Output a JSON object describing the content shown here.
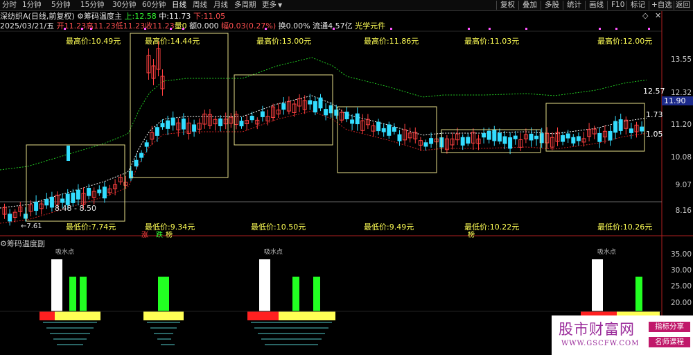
{
  "toolbar": {
    "periods": [
      "分时",
      "1分钟",
      "5分钟",
      "15分钟",
      "30分钟",
      "60分钟",
      "日线",
      "周线",
      "月线",
      "多周期",
      "更多"
    ],
    "active": "日线",
    "right": [
      "复权",
      "叠加",
      "多股",
      "统计",
      "画线",
      "F10",
      "标记",
      "+自选",
      "返回"
    ]
  },
  "info": {
    "stock": "深纺织A",
    "adj": "(日线,前复权)",
    "indicator": "筹码温度主",
    "up_label": "上:",
    "up_value": "12.58",
    "mid_label": "中:",
    "mid_value": "11.73",
    "low_label": "下:",
    "low_value": "11.05"
  },
  "quote": {
    "date": "2025/03/21/五",
    "open": "开11.23",
    "high": "高11.23",
    "low": "低11.23",
    "close": "收11.23",
    "vol": "量0",
    "amt": "额0.000",
    "chg": "幅0.03(0.27%)",
    "turn": "换0.00%",
    "float": "流通4.57亿",
    "concept": "光学元件"
  },
  "boxes": [
    {
      "top": "最高价:10.49元",
      "bottom": "最低价:7.74元"
    },
    {
      "top": "最高价:14.44元",
      "bottom": "最低价:9.34元"
    },
    {
      "top": "最高价:13.00元",
      "bottom": "最低价:10.50元"
    },
    {
      "top": "最高价:11.86元",
      "bottom": "最低价:9.49元"
    },
    {
      "top": "最高价:11.03元",
      "bottom": "最低价:10.22元"
    },
    {
      "top": "最高价:12.00元",
      "bottom": "最低价:10.26元"
    }
  ],
  "annotations": {
    "range": "8.48 - 8.50",
    "low_mark": "7.61",
    "right_high": "12.57",
    "right_mid": "1.73",
    "right_low": "1.05"
  },
  "axis": [
    "13.55",
    "12.32",
    "11.20",
    "10.08",
    "9.07",
    "8.16"
  ],
  "current_price": "11.90",
  "tags": [
    "涨",
    "跌",
    "榜",
    "榜"
  ],
  "sub": {
    "title": "筹码温度副",
    "axis": [
      "35.00",
      "30.00",
      "25.00",
      "20.00"
    ],
    "peak_labels": [
      "吸水点",
      "吸水点",
      "吸水点"
    ]
  },
  "watermark": {
    "title": "股市财富网",
    "url": "WWW.GSCFW.COM",
    "badge1": "指标分享",
    "badge2": "名师课程"
  },
  "colors": {
    "up": "#ff4040",
    "down": "#33ddff",
    "box": "#e8e08a",
    "yellow": "#ffff55",
    "green": "#22ff22",
    "red": "#ff2020"
  }
}
